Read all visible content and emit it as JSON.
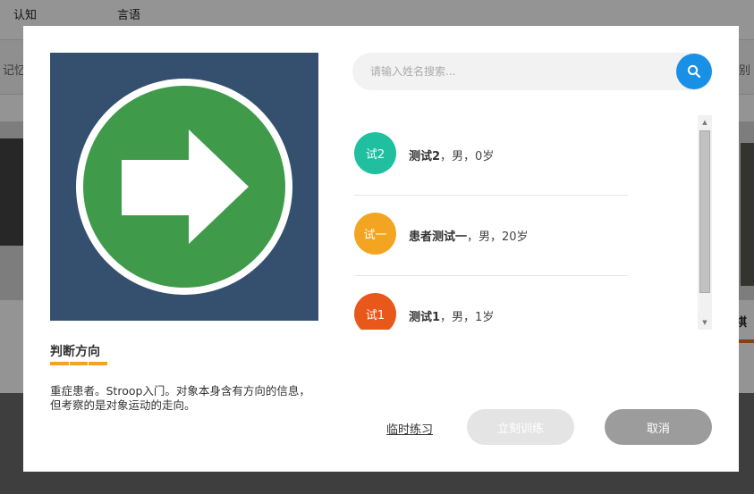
{
  "background": {
    "tabs": [
      "认知",
      "言语"
    ],
    "subnav": [
      "记忆",
      "别"
    ],
    "card_label": "棋"
  },
  "modal": {
    "game_title": "判断方向",
    "game_description": "重症患者。Stroop入门。对象本身含有方向的信息，但考察的是对象运动的走向。",
    "search": {
      "placeholder": "请输入姓名搜索..."
    },
    "patients": [
      {
        "avatar_text": "试2",
        "avatar_color": "#1fbf9f",
        "name": "测试2",
        "details": "，男，0岁"
      },
      {
        "avatar_text": "试一",
        "avatar_color": "#f3a521",
        "name": "患者测试一",
        "details": "，男，20岁"
      },
      {
        "avatar_text": "试1",
        "avatar_color": "#e8581a",
        "name": "测试1",
        "details": "，男，1岁"
      }
    ],
    "practice_label": "临时练习",
    "train_label": "立刻训练",
    "cancel_label": "取消"
  },
  "colors": {
    "search_button": "#1a8fe6",
    "thumbnail_bg": "#35506f",
    "arrow_circle": "#3f9b4a",
    "title_underline": "#f0a522"
  },
  "icons": {
    "search": "search-icon",
    "thumbnail": "right-arrow-icon",
    "scroll_up": "scroll-up-icon",
    "scroll_down": "scroll-down-icon"
  }
}
